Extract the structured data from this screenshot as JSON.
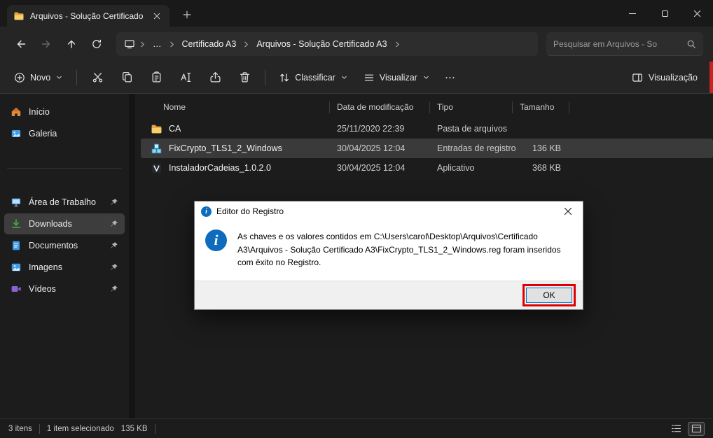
{
  "window": {
    "tab_title": "Arquivos - Solução Certificado"
  },
  "navbar": {
    "breadcrumb_ellipsis": "…",
    "breadcrumb_items": [
      "Certificado A3",
      "Arquivos - Solução Certificado A3"
    ],
    "search_placeholder": "Pesquisar em Arquivos - So"
  },
  "toolbar": {
    "new": "Novo",
    "sort": "Classificar",
    "view": "Visualizar",
    "more": "···",
    "preview": "Visualização"
  },
  "sidebar": {
    "items": [
      {
        "label": "Início"
      },
      {
        "label": "Galeria"
      },
      {
        "label": "Área de Trabalho"
      },
      {
        "label": "Downloads"
      },
      {
        "label": "Documentos"
      },
      {
        "label": "Imagens"
      },
      {
        "label": "Vídeos"
      }
    ]
  },
  "files": {
    "columns": [
      "Nome",
      "Data de modificação",
      "Tipo",
      "Tamanho"
    ],
    "rows": [
      {
        "name": "CA",
        "modified": "25/11/2020 22:39",
        "type": "Pasta de arquivos",
        "size": ""
      },
      {
        "name": "FixCrypto_TLS1_2_Windows",
        "modified": "30/04/2025 12:04",
        "type": "Entradas de registro",
        "size": "136 KB"
      },
      {
        "name": "InstaladorCadeias_1.0.2.0",
        "modified": "30/04/2025 12:04",
        "type": "Aplicativo",
        "size": "368 KB"
      }
    ]
  },
  "dialog": {
    "title": "Editor do Registro",
    "info_glyph": "i",
    "message": "As chaves e os valores contidos em C:\\Users\\carol\\Desktop\\Arquivos\\Certificado A3\\Arquivos - Solução Certificado A3\\FixCrypto_TLS1_2_Windows.reg foram inseridos com êxito no Registro.",
    "ok": "OK"
  },
  "statusbar": {
    "count": "3 itens",
    "selected": "1 item selecionado",
    "size": "135 KB"
  },
  "colors": {
    "accent": "#0078d4",
    "annotation_red": "#e00000",
    "folder_yellow": "#f8cf68",
    "info_blue": "#0f6cbd",
    "downloads_green": "#43b049"
  }
}
